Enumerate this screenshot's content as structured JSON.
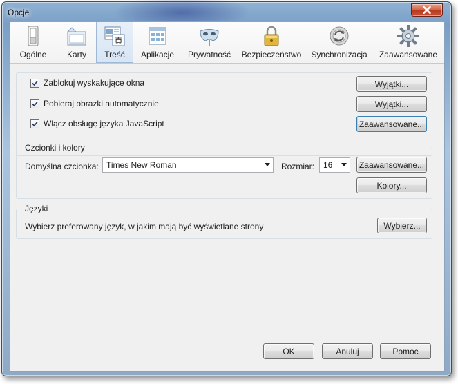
{
  "window": {
    "title": "Opcje"
  },
  "toolbar": {
    "items": [
      {
        "label": "Ogólne",
        "icon": "switch-icon"
      },
      {
        "label": "Karty",
        "icon": "tabs-icon"
      },
      {
        "label": "Treść",
        "icon": "content-icon",
        "selected": true
      },
      {
        "label": "Aplikacje",
        "icon": "applications-icon"
      },
      {
        "label": "Prywatność",
        "icon": "mask-icon"
      },
      {
        "label": "Bezpieczeństwo",
        "icon": "padlock-icon"
      },
      {
        "label": "Synchronizacja",
        "icon": "sync-icon"
      },
      {
        "label": "Zaawansowane",
        "icon": "gear-icon"
      }
    ]
  },
  "content": {
    "popups": {
      "label": "Zablokuj wyskakujące okna",
      "checked": true,
      "button": "Wyjątki..."
    },
    "images": {
      "label": "Pobieraj obrazki automatycznie",
      "checked": true,
      "button": "Wyjątki..."
    },
    "javascript": {
      "label": "Włącz obsługę języka JavaScript",
      "checked": true,
      "button": "Zaawansowane..."
    }
  },
  "fonts": {
    "title": "Czcionki i kolory",
    "default_font_label": "Domyślna czcionka:",
    "default_font_value": "Times New Roman",
    "size_label": "Rozmiar:",
    "size_value": "16",
    "advanced_button": "Zaawansowane...",
    "colors_button": "Kolory..."
  },
  "languages": {
    "title": "Języki",
    "description": "Wybierz preferowany język, w jakim mają być wyświetlane strony",
    "choose_button": "Wybierz..."
  },
  "footer": {
    "ok": "OK",
    "cancel": "Anuluj",
    "help": "Pomoc"
  },
  "colors": {
    "selected_tab_bg": "#d7e5f4",
    "close_button": "#c9523a",
    "frame": "#8fb1d3"
  }
}
